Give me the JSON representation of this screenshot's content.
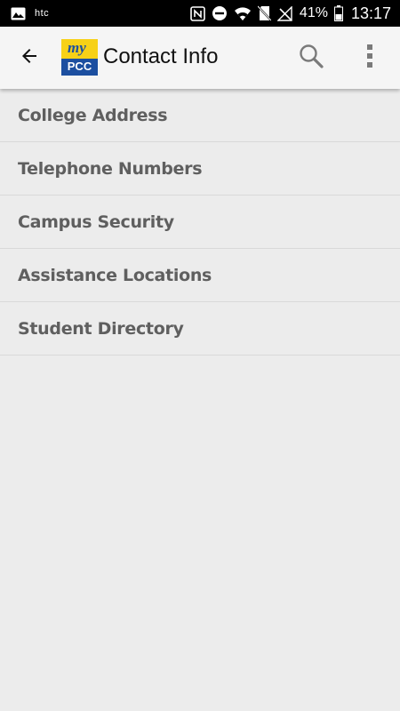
{
  "status_bar": {
    "brand": "htc",
    "battery_percent": "41%",
    "time": "13:17",
    "icons": [
      "gallery-icon",
      "nfc-icon",
      "do-not-disturb-icon",
      "wifi-icon",
      "no-sim-icon",
      "signal-off-icon",
      "battery-icon"
    ]
  },
  "app_bar": {
    "title": "Contact Info",
    "logo": {
      "top_text": "my",
      "bottom_text": "PCC"
    },
    "back_icon": "back-arrow-icon",
    "search_icon": "search-icon",
    "overflow_icon": "more-vert-icon"
  },
  "menu": {
    "items": [
      {
        "label": "College Address"
      },
      {
        "label": "Telephone Numbers"
      },
      {
        "label": "Campus Security"
      },
      {
        "label": "Assistance Locations"
      },
      {
        "label": "Student Directory"
      }
    ]
  },
  "colors": {
    "status_bar_bg": "#000000",
    "app_bar_bg": "#f5f5f5",
    "page_bg": "#ececec",
    "item_text": "#5f5f5f",
    "logo_blue": "#1c4fa0",
    "logo_yellow": "#f7d117"
  }
}
